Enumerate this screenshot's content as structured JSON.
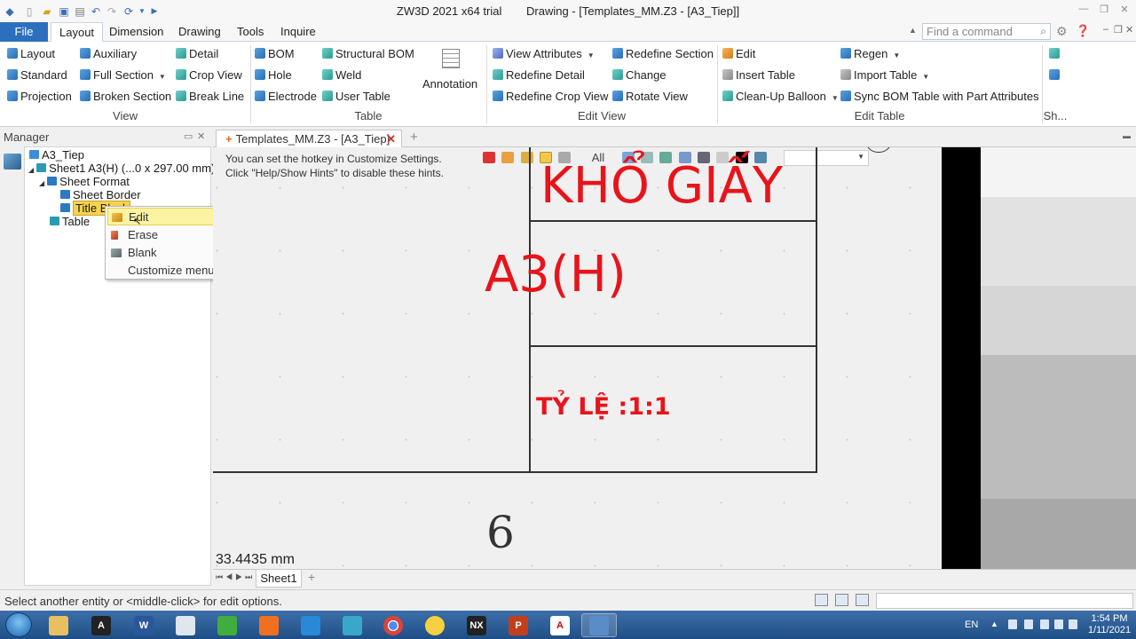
{
  "app": {
    "product": "ZW3D 2021 x64 trial",
    "document": "Drawing - [Templates_MM.Z3 - [A3_Tiep]]"
  },
  "menu": {
    "tabs": [
      "File",
      "Layout",
      "Dimension",
      "Drawing",
      "Tools",
      "Inquire"
    ],
    "active": "Layout",
    "search_placeholder": "Find a command"
  },
  "ribbon": {
    "view": {
      "label": "View",
      "items": [
        "Layout",
        "Auxiliary",
        "Detail",
        "Standard",
        "Full Section",
        "Crop View",
        "Projection",
        "Broken Section",
        "Break Line"
      ]
    },
    "table": {
      "label": "Table",
      "items": [
        "BOM",
        "Structural BOM",
        "Hole",
        "Weld",
        "Electrode",
        "User Table"
      ],
      "annotation": "Annotation"
    },
    "edit_view": {
      "label": "Edit View",
      "items": [
        "View Attributes",
        "Redefine Section",
        "Redefine Detail",
        "Change",
        "Redefine Crop View",
        "Rotate View"
      ]
    },
    "edit_table": {
      "label": "Edit Table",
      "items": [
        "Edit",
        "Regen",
        "Insert Table",
        "Import Table",
        "Clean-Up Balloon",
        "Sync BOM Table with Part Attributes"
      ]
    },
    "sh_label": "Sh..."
  },
  "manager": {
    "title": "Manager",
    "tree": [
      {
        "label": "A3_Tiep"
      },
      {
        "label": "Sheet1 A3(H) (...0 x 297.00 mm)"
      },
      {
        "label": "Sheet Format"
      },
      {
        "label": "Sheet Border"
      },
      {
        "label": "Title Block"
      },
      {
        "label": "Table"
      }
    ]
  },
  "context_menu": {
    "items": [
      "Edit",
      "Erase",
      "Blank",
      "Customize menu"
    ],
    "highlighted": "Edit"
  },
  "document_tab": {
    "label": "Templates_MM.Z3 - [A3_Tiep]"
  },
  "canvas": {
    "hint_line1": "You can set the hotkey in Customize Settings.",
    "hint_line2": "Click \"Help/Show Hints\" to disable these hints.",
    "filter": "All",
    "title_text": "KHỔ GIẤY",
    "size_text": "A3(H)",
    "scale_text": "TỶ LỆ :1:1",
    "handwritten": "6",
    "dim_readout": "33.4435 mm"
  },
  "sheet_tab": "Sheet1",
  "status": {
    "text": "Select another entity or <middle-click> for edit options."
  },
  "taskbar": {
    "lang": "EN",
    "time": "1:54 PM",
    "date": "1/11/2021",
    "apps": [
      "explorer",
      "autodesk",
      "word",
      "zw-app",
      "green-app",
      "orange-app",
      "blue-app",
      "teal-app",
      "chrome",
      "yellow-app",
      "nx",
      "powerpoint",
      "acrobat",
      "zw3d"
    ]
  },
  "colors": {
    "accent": "#2d6fbf",
    "drawing_red": "#e8141b",
    "context_highlight": "#fbf3a2"
  }
}
